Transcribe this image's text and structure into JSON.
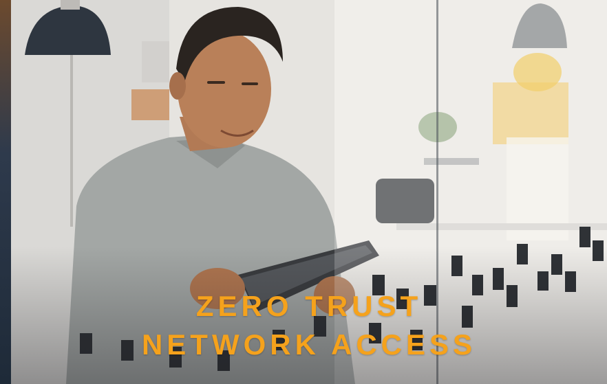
{
  "headline": {
    "line1": "ZERO TRUST",
    "line2": "NETWORK ACCESS"
  },
  "colors": {
    "headline": "#f5a21c",
    "background": "#e9e8e5"
  },
  "image": {
    "subject": "man-using-tablet-photo"
  }
}
